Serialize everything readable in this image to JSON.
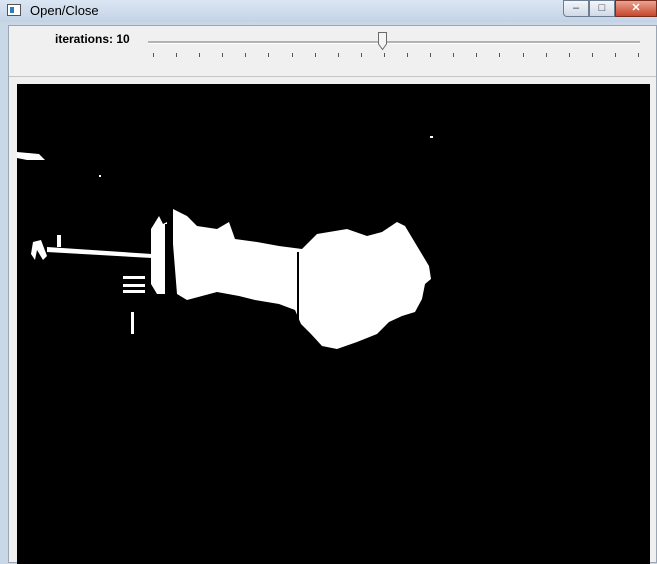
{
  "window": {
    "title": "Open/Close",
    "app_icon": "window-app-icon",
    "controls": {
      "minimize_icon": "minimize-icon",
      "maximize_icon": "maximize-icon",
      "close_icon": "close-icon"
    }
  },
  "trackbar": {
    "label": "iterations: 10",
    "value": 10,
    "position_fraction": 0.48,
    "tick_count": 22
  },
  "image": {
    "description_type": "binary morphology result",
    "background_color": "#000000",
    "foreground_color": "#ffffff"
  }
}
